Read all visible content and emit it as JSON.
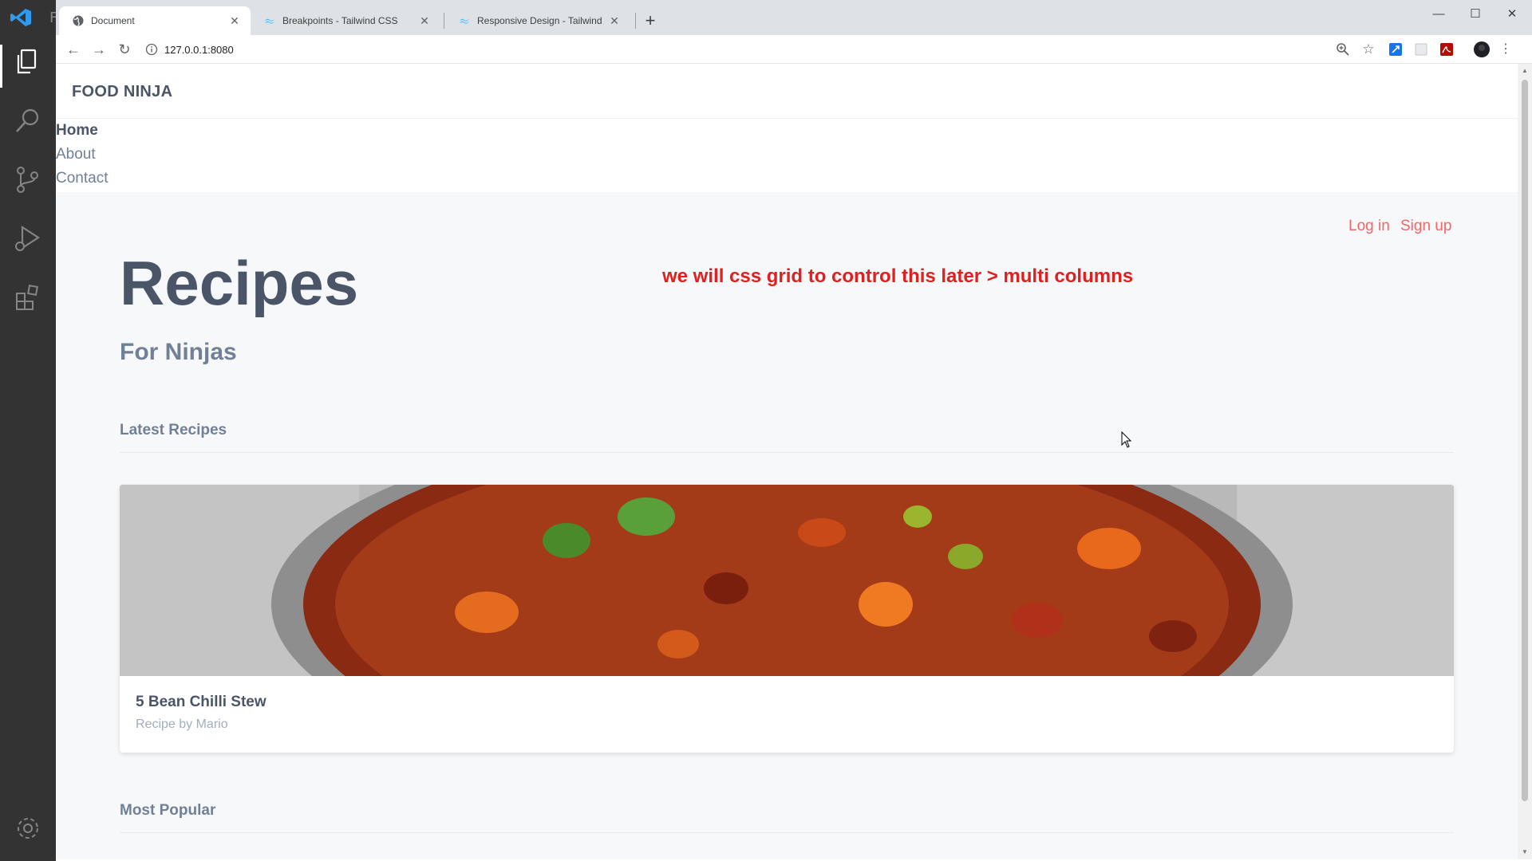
{
  "editor": {
    "activity_icons": [
      "explorer-icon",
      "search-icon",
      "source-control-icon",
      "run-debug-icon",
      "extensions-icon",
      "settings-gear-icon"
    ],
    "title_fragment": "F"
  },
  "browser": {
    "tabs": [
      {
        "title": "Document",
        "active": true
      },
      {
        "title": "Breakpoints - Tailwind CSS",
        "active": false
      },
      {
        "title": "Responsive Design - Tailwind CSS",
        "active": false
      }
    ],
    "url": "127.0.0.1:8080"
  },
  "page": {
    "brand": "FOOD NINJA",
    "nav": [
      "Home",
      "About",
      "Contact"
    ],
    "auth": {
      "login": "Log in",
      "signup": "Sign up"
    },
    "hero": {
      "title": "Recipes",
      "subtitle": "For Ninjas"
    },
    "annotation": "we will css grid to control this later > multi columns",
    "sections": {
      "latest": "Latest Recipes",
      "popular": "Most Popular"
    },
    "card": {
      "title": "5 Bean Chilli Stew",
      "author": "Recipe by Mario"
    }
  },
  "colors": {
    "accent_red": "#f56565",
    "annotation_red": "#e0201f",
    "text_dark": "#4a5568",
    "text_muted": "#718096"
  }
}
